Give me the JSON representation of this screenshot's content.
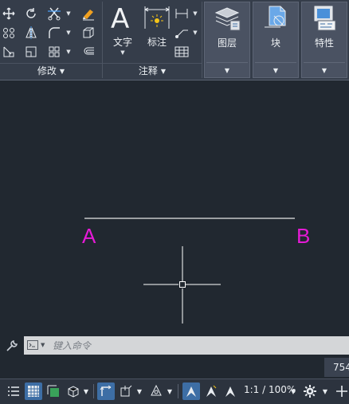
{
  "ribbon": {
    "modify_panel_title": "修改",
    "annotation_panel_title": "注释",
    "text_tool_label": "文字",
    "dimension_tool_label": "标注",
    "layers_label": "图层",
    "block_label": "块",
    "properties_label": "特性",
    "text_glyph": "A"
  },
  "canvas": {
    "point_a": "A",
    "point_b": "B",
    "line_color": "#e6e6e6",
    "label_color": "#e51ad6"
  },
  "command": {
    "placeholder": "键入命令"
  },
  "coordinates": {
    "value": "754"
  },
  "statusbar": {
    "scale": "1:1 / 100%",
    "accent": "#3d6ea5"
  }
}
